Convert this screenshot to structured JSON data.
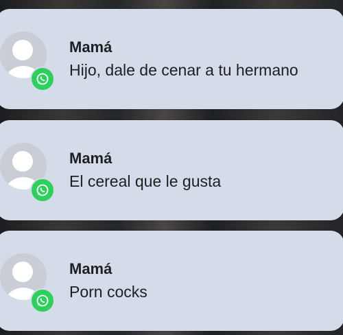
{
  "notifications": [
    {
      "sender": "Mamá",
      "message": "Hijo, dale de cenar a tu hermano",
      "avatar_icon": "default-contact-avatar-icon",
      "app_icon": "whatsapp-icon",
      "app_color": "#2ecf5c"
    },
    {
      "sender": "Mamá",
      "message": "El cereal que le gusta",
      "avatar_icon": "default-contact-avatar-icon",
      "app_icon": "whatsapp-icon",
      "app_color": "#2ecf5c"
    },
    {
      "sender": "Mamá",
      "message": "Porn cocks",
      "avatar_icon": "default-contact-avatar-icon",
      "app_icon": "whatsapp-icon",
      "app_color": "#2ecf5c"
    }
  ]
}
